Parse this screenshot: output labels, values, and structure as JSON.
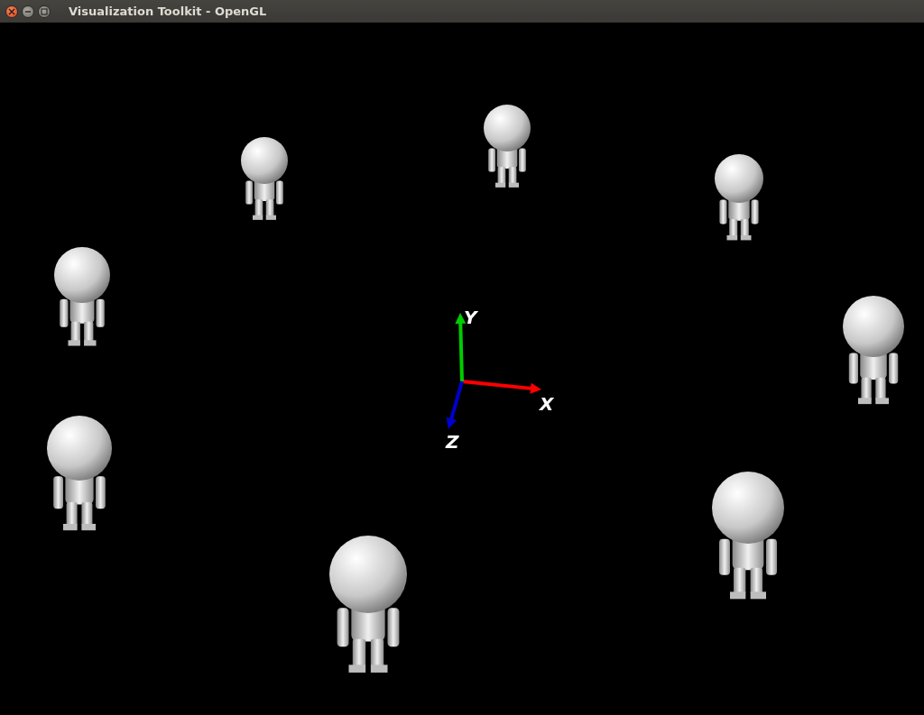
{
  "window": {
    "title": "Visualization Toolkit - OpenGL"
  },
  "axes": [
    {
      "label": "X",
      "color": "#ff0000"
    },
    {
      "label": "Y",
      "color": "#00cc00"
    },
    {
      "label": "Z",
      "color": "#0000cc"
    }
  ]
}
